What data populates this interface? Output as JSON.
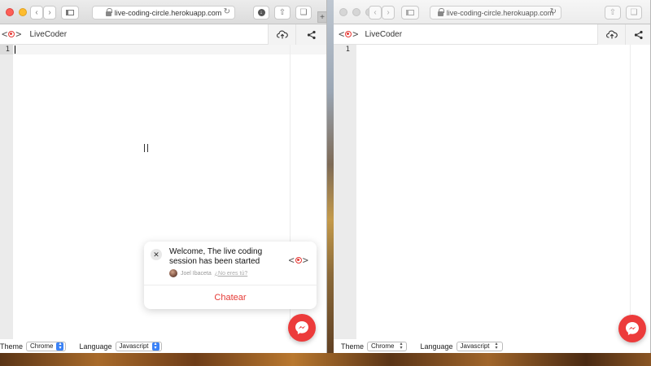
{
  "browser": {
    "url": "live-coding-circle.herokuapp.com"
  },
  "app": {
    "title": "LiveCoder",
    "logo_text_left": "<",
    "logo_text_right": ">"
  },
  "editor": {
    "line_numbers": [
      "1"
    ]
  },
  "statusbar": {
    "theme_label": "Theme",
    "theme_value": "Chrome",
    "language_label": "Language",
    "language_value": "Javascript"
  },
  "chat": {
    "message": "Welcome, The live coding session has been started",
    "author": "Joel Ibaceta",
    "not_me": "¿No eres tú?",
    "button_label": "Chatear"
  },
  "colors": {
    "accent": "#e53935",
    "messenger": "#ec3b3b"
  },
  "icons": {
    "upload": "cloud-upload-icon",
    "share": "share-icon",
    "messenger": "messenger-icon",
    "close": "close-icon"
  }
}
